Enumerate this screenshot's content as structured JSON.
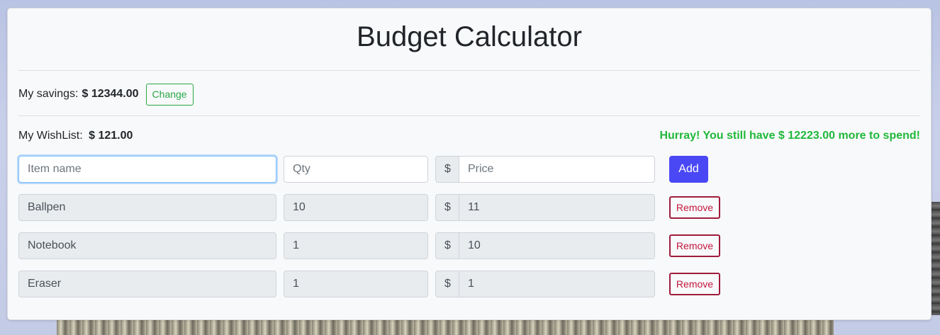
{
  "app": {
    "title": "Budget Calculator"
  },
  "savings": {
    "label": "My savings:",
    "amount": "$ 12344.00",
    "change_label": "Change"
  },
  "wishlist": {
    "label": "My WishList:",
    "total": "$ 121.00",
    "status": "Hurray! You still have $ 12223.00 more to spend!"
  },
  "form": {
    "name_placeholder": "Item name",
    "qty_placeholder": "Qty",
    "price_placeholder": "Price",
    "currency": "$",
    "add_label": "Add"
  },
  "items": [
    {
      "name": "Ballpen",
      "qty": "10",
      "currency": "$",
      "price": "11",
      "remove_label": "Remove"
    },
    {
      "name": "Notebook",
      "qty": "1",
      "currency": "$",
      "price": "10",
      "remove_label": "Remove"
    },
    {
      "name": "Eraser",
      "qty": "1",
      "currency": "$",
      "price": "1",
      "remove_label": "Remove"
    }
  ],
  "colors": {
    "accent": "#4a48f5",
    "success": "#20b83a",
    "danger": "#c5183f",
    "card_bg": "#f8f9fa"
  }
}
